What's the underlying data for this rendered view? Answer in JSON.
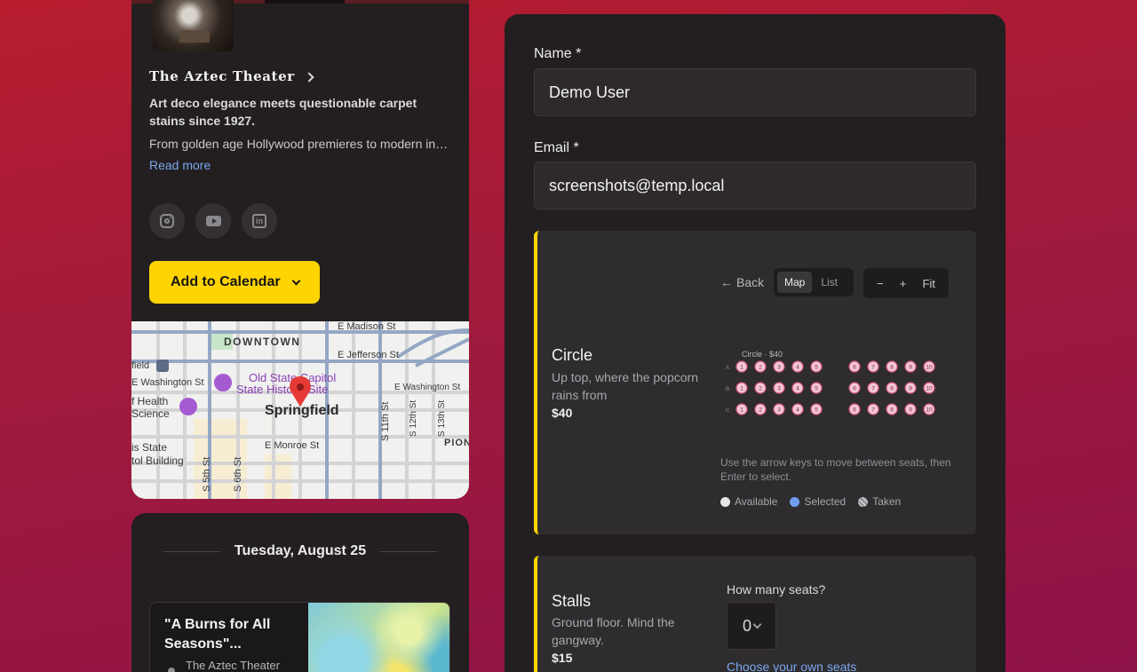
{
  "venue": {
    "name": "The Aztec Theater",
    "tagline": "Art deco elegance meets questionable carpet stains since 1927.",
    "description": "From golden age Hollywood premieres to modern indie screenings, the Aztec has seen it all.",
    "read_more": "Read more",
    "social": [
      "instagram-icon",
      "youtube-icon",
      "linkedin-icon"
    ],
    "add_to_calendar": "Add to Calendar"
  },
  "map": {
    "labels": {
      "downtown": "DOWNTOWN",
      "madison": "E Madison St",
      "jefferson": "E Jefferson St",
      "washington_w": "E Washington St",
      "washington_e": "E Washington St",
      "capitol1": "Old State Capitol",
      "capitol2": "State Historic Site",
      "health1": "f Health",
      "health2": "Science",
      "city": "Springfield",
      "field": "field",
      "monroe": "E Monroe St",
      "state1": "is State",
      "state2": "tol Building",
      "fifth": "S 5th St",
      "sixth": "S 6th St",
      "eleventh": "S 11th St",
      "twelfth": "S 12th St",
      "thirteenth": "S 13th St",
      "pion": "PION"
    }
  },
  "schedule": {
    "date": "Tuesday, August 25",
    "event": {
      "title": "\"A Burns for All Seasons\"...",
      "venue": "The Aztec Theater"
    }
  },
  "form": {
    "name_label": "Name *",
    "name_value": "Demo User",
    "email_label": "Email *",
    "email_value": "screenshots@temp.local"
  },
  "circle": {
    "name": "Circle",
    "description": "Up top, where the popcorn rains from",
    "price": "$40",
    "controls": {
      "back": "Back",
      "map": "Map",
      "list": "List",
      "zoom_out": "−",
      "zoom_in": "+",
      "fit": "Fit"
    },
    "seatmap": {
      "caption": "Circle · $40",
      "rows": [
        "A",
        "B",
        "C"
      ],
      "left_seats": [
        "1",
        "2",
        "3",
        "4",
        "5"
      ],
      "right_seats": [
        "6",
        "7",
        "8",
        "9",
        "10"
      ]
    },
    "hint": "Use the arrow keys to move between seats, then Enter to select.",
    "legend": {
      "available": "Available",
      "selected": "Selected",
      "taken": "Taken"
    },
    "colors": {
      "seat_fill": "#f3c6d6",
      "seat_stroke": "#d4567e",
      "available": "#e6e6e8",
      "selected": "#6f9df2",
      "taken": "#8a8a8e",
      "accent": "#ffd400"
    }
  },
  "stalls": {
    "name": "Stalls",
    "description": "Ground floor. Mind the gangway.",
    "price": "$15",
    "seats_question": "How many seats?",
    "seats_value": "0",
    "choose_link": "Choose your own seats"
  }
}
